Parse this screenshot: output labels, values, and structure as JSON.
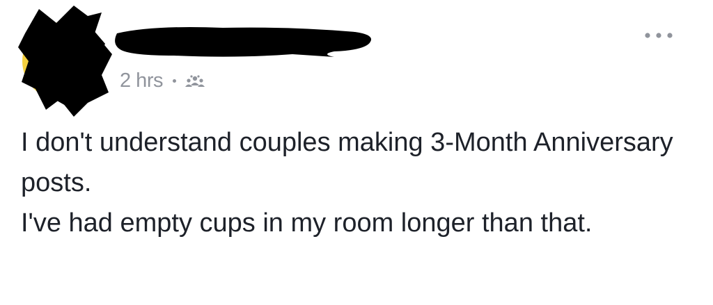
{
  "post": {
    "timestamp": "2 hrs",
    "audience_icon": "friends-icon",
    "more_icon": "more-options-icon",
    "lines": [
      "I don't understand couples making 3-Month Anniversary posts.",
      "I've had empty cups in my room longer than that."
    ]
  },
  "colors": {
    "meta_text": "#90949c",
    "body_text": "#1d2129",
    "redaction": "#000000"
  }
}
